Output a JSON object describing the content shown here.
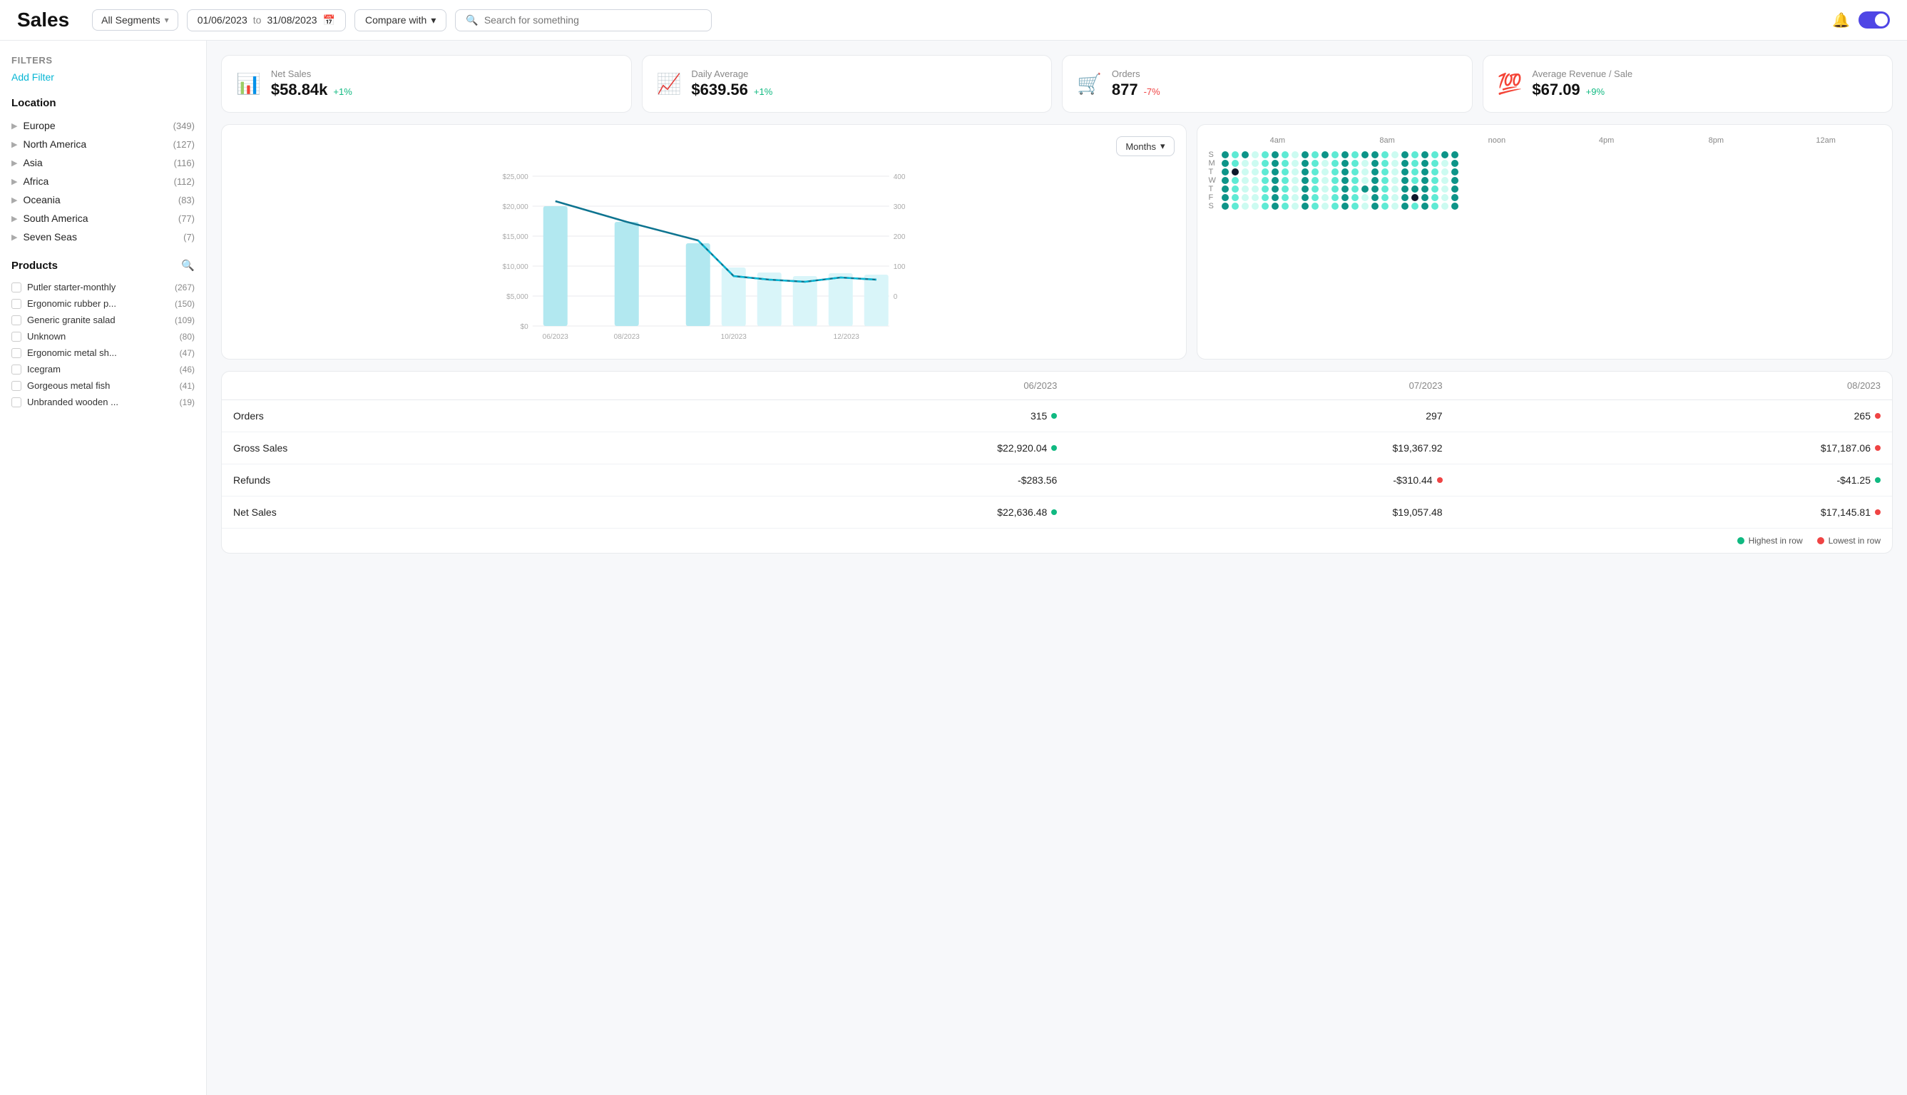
{
  "header": {
    "title": "Sales",
    "segment_label": "All Segments",
    "date_from": "01/06/2023",
    "date_to": "31/08/2023",
    "date_separator": "to",
    "compare_label": "Compare with",
    "search_placeholder": "Search for something"
  },
  "filters": {
    "title": "Filters",
    "add_filter_label": "Add Filter",
    "location_title": "Location",
    "locations": [
      {
        "name": "Europe",
        "count": "(349)"
      },
      {
        "name": "North America",
        "count": "(127)"
      },
      {
        "name": "Asia",
        "count": "(116)"
      },
      {
        "name": "Africa",
        "count": "(112)"
      },
      {
        "name": "Oceania",
        "count": "(83)"
      },
      {
        "name": "South America",
        "count": "(77)"
      },
      {
        "name": "Seven Seas",
        "count": "(7)"
      }
    ],
    "products_title": "Products",
    "products": [
      {
        "name": "Putler starter-monthly",
        "count": "(267)"
      },
      {
        "name": "Ergonomic rubber p...",
        "count": "(150)"
      },
      {
        "name": "Generic granite salad",
        "count": "(109)"
      },
      {
        "name": "Unknown",
        "count": "(80)"
      },
      {
        "name": "Ergonomic metal sh...",
        "count": "(47)"
      },
      {
        "name": "Icegram",
        "count": "(46)"
      },
      {
        "name": "Gorgeous metal fish",
        "count": "(41)"
      },
      {
        "name": "Unbranded wooden ...",
        "count": "(19)"
      }
    ]
  },
  "kpis": [
    {
      "id": "net-sales",
      "icon": "📊",
      "label": "Net Sales",
      "value": "$58.84k",
      "change": "+1%",
      "positive": true
    },
    {
      "id": "daily-average",
      "icon": "📈",
      "label": "Daily Average",
      "value": "$639.56",
      "change": "+1%",
      "positive": true
    },
    {
      "id": "orders",
      "icon": "🛒",
      "label": "Orders",
      "value": "877",
      "change": "-7%",
      "positive": false
    },
    {
      "id": "avg-revenue",
      "icon": "💯",
      "label": "Average Revenue / Sale",
      "value": "$67.09",
      "change": "+9%",
      "positive": true
    }
  ],
  "chart": {
    "months_label": "Months",
    "y_left_labels": [
      "$25,000",
      "$20,000",
      "$15,000",
      "$10,000",
      "$5,000",
      "$0"
    ],
    "y_right_labels": [
      "400",
      "300",
      "200",
      "100",
      "0"
    ],
    "x_labels": [
      "06/2023",
      "08/2023",
      "10/2023",
      "12/2023"
    ]
  },
  "heatmap": {
    "time_labels": [
      "4am",
      "8am",
      "noon",
      "4pm",
      "8pm",
      "12am"
    ],
    "days": [
      "S",
      "M",
      "T",
      "W",
      "T",
      "F",
      "S"
    ]
  },
  "table": {
    "columns": [
      "",
      "06/2023",
      "07/2023",
      "08/2023"
    ],
    "rows": [
      {
        "metric": "Orders",
        "values": [
          "315",
          "297",
          "265"
        ],
        "dots": [
          "green",
          null,
          "red"
        ]
      },
      {
        "metric": "Gross Sales",
        "values": [
          "$22,920.04",
          "$19,367.92",
          "$17,187.06"
        ],
        "dots": [
          "green",
          null,
          "red"
        ]
      },
      {
        "metric": "Refunds",
        "values": [
          "-$283.56",
          "-$310.44",
          "-$41.25"
        ],
        "dots": [
          null,
          "red",
          "green"
        ]
      },
      {
        "metric": "Net Sales",
        "values": [
          "$22,636.48",
          "$19,057.48",
          "$17,145.81"
        ],
        "dots": [
          "green",
          null,
          "red"
        ]
      }
    ],
    "legend": {
      "highest": "Highest in row",
      "lowest": "Lowest in row"
    }
  }
}
